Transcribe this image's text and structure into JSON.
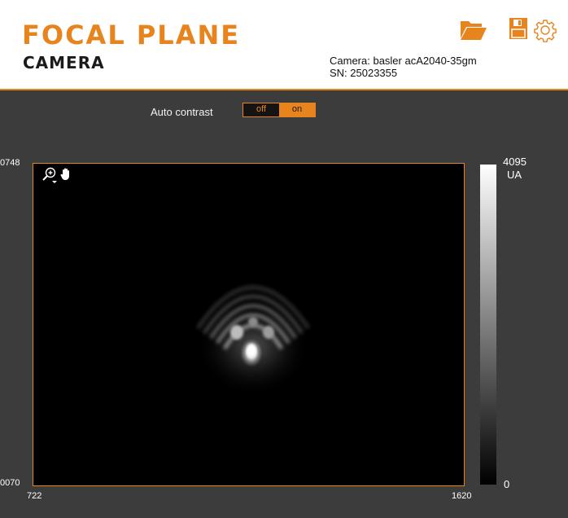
{
  "header": {
    "title": "FOCAL PLANE",
    "subtitle": "CAMERA",
    "camera_line": "Camera: basler acA2040-35gm",
    "serial_line": "SN: 25023355",
    "icons": [
      "folder-open-icon",
      "save-icon",
      "gear-icon"
    ],
    "accent_color": "#e8841e"
  },
  "controls": {
    "auto_contrast_label": "Auto contrast",
    "toggle_off_label": "off",
    "toggle_on_label": "on",
    "selected": "on"
  },
  "image": {
    "y_max_label": "0748",
    "y_min_label": "0070",
    "x_min_label": "722",
    "x_max_label": "1620",
    "tools": [
      "zoom-icon",
      "pan-hand-icon"
    ]
  },
  "colorbar": {
    "max_label": "4095",
    "unit_label": "UA",
    "min_label": "0"
  }
}
